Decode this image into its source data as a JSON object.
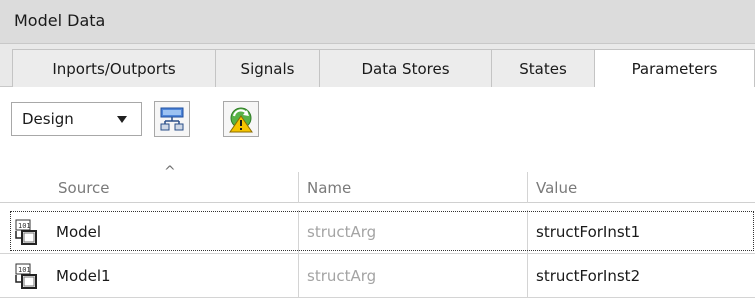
{
  "window": {
    "title": "Model Data"
  },
  "tabs": [
    {
      "label": "Inports/Outports",
      "active": false
    },
    {
      "label": "Signals",
      "active": false
    },
    {
      "label": "Data Stores",
      "active": false
    },
    {
      "label": "States",
      "active": false
    },
    {
      "label": "Parameters",
      "active": true
    }
  ],
  "toolbar": {
    "view_dropdown": {
      "selected": "Design"
    },
    "buttons": [
      {
        "icon": "hierarchy-icon"
      },
      {
        "icon": "refresh-warning-icon"
      }
    ]
  },
  "table": {
    "sorted_column": "Source",
    "columns": [
      "Source",
      "Name",
      "Value"
    ],
    "rows": [
      {
        "source": "Model",
        "name": "structArg",
        "value": "structForInst1",
        "selected": true
      },
      {
        "source": "Model1",
        "name": "structArg",
        "value": "structForInst2",
        "selected": false
      }
    ]
  },
  "colors": {
    "titlebar_bg": "#dcdcdc",
    "tabbar_bg": "#e9e9e9",
    "muted_text": "#a4a4a4"
  }
}
